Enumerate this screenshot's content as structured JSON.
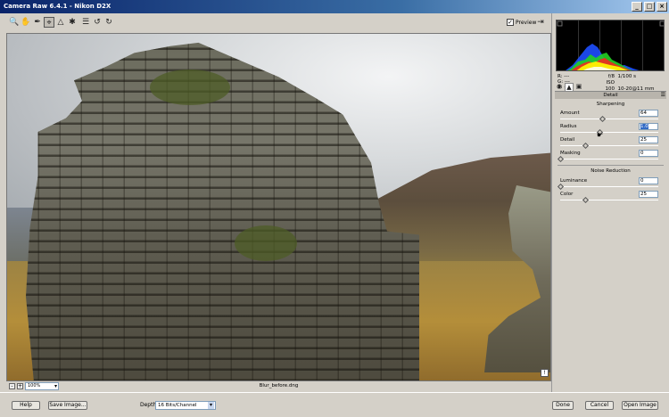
{
  "window": {
    "title": "Camera Raw 6.4.1  -  Nikon D2X",
    "minimize": "_",
    "maximize": "□",
    "close": "×"
  },
  "toolbar": {
    "icons": [
      "zoom-tool",
      "hand-tool",
      "white-balance-tool",
      "color-sampler-tool",
      "crop-tool",
      "straighten-tool",
      "spot-removal-tool",
      "preferences",
      "rotate-ccw",
      "rotate-cw"
    ],
    "preview_label": "Preview",
    "preview_checked": true
  },
  "histogram": {
    "colors": [
      "#00ffff",
      "#ffff00",
      "#ff00ff",
      "#ff0000",
      "#00ff00",
      "#0000ff",
      "#ffffff"
    ]
  },
  "readouts": {
    "r": "R:  ---",
    "g": "G:  ---",
    "b": "B:  ---",
    "aperture": "f/8",
    "shutter": "1/100 s",
    "iso": "ISO 100",
    "lens": "10-20@11 mm"
  },
  "panel": {
    "title": "Detail",
    "sharpening_title": "Sharpening",
    "noise_title": "Noise Reduction",
    "sliders": {
      "amount": {
        "label": "Amount",
        "value": "64",
        "fraction": 0.43
      },
      "radius": {
        "label": "Radius",
        "value": "1.0",
        "fraction": 0.4
      },
      "detail": {
        "label": "Detail",
        "value": "25",
        "fraction": 0.25
      },
      "masking": {
        "label": "Masking",
        "value": "0",
        "fraction": 0.0
      },
      "luminance": {
        "label": "Luminance",
        "value": "0",
        "fraction": 0.0
      },
      "color": {
        "label": "Color",
        "value": "25",
        "fraction": 0.25
      }
    }
  },
  "status": {
    "zoom": "100%",
    "filename": "Blur_before.dng"
  },
  "bottom": {
    "help": "Help",
    "save": "Save Image...",
    "depth_label": "Depth:",
    "depth_value": "16 Bits/Channel",
    "done": "Done",
    "cancel": "Cancel",
    "open": "Open Image"
  }
}
